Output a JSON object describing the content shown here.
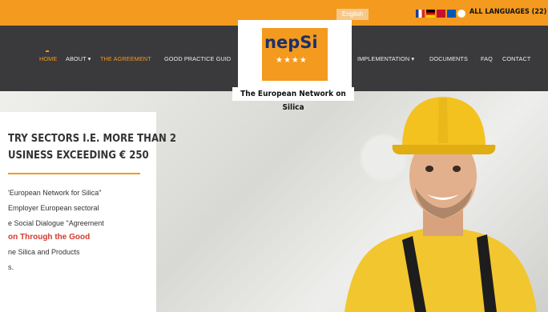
{
  "topbar": {
    "current_language": "English",
    "all_languages": "ALL LANGUAGES (22)"
  },
  "nav": {
    "home": "HOME",
    "about": "ABOUT",
    "agreement": "THE AGREEMENT",
    "good_practice": "GOOD PRACTICE GUID",
    "implementation": "IMPLEMENTATION",
    "documents": "DOCUMENTS",
    "faq": "FAQ",
    "contact": "CONTACT"
  },
  "logo": {
    "name": "nepSi",
    "tagline": "The European Network on Silica"
  },
  "card": {
    "heading_line1": "TRY SECTORS I.E. MORE THAN 2",
    "heading_line2": "USINESS EXCEEDING € 250",
    "lines": [
      "'European Network for Silica\"",
      "Employer European sectoral",
      "e Social Dialogue \"Agreement"
    ],
    "highlight": "on Through the Good",
    "line_after": "ne Silica and Products",
    "line_last": "s."
  },
  "colors": {
    "accent": "#f39a1f",
    "nav_bg": "#3a3a3c",
    "highlight": "#d33a2f"
  }
}
